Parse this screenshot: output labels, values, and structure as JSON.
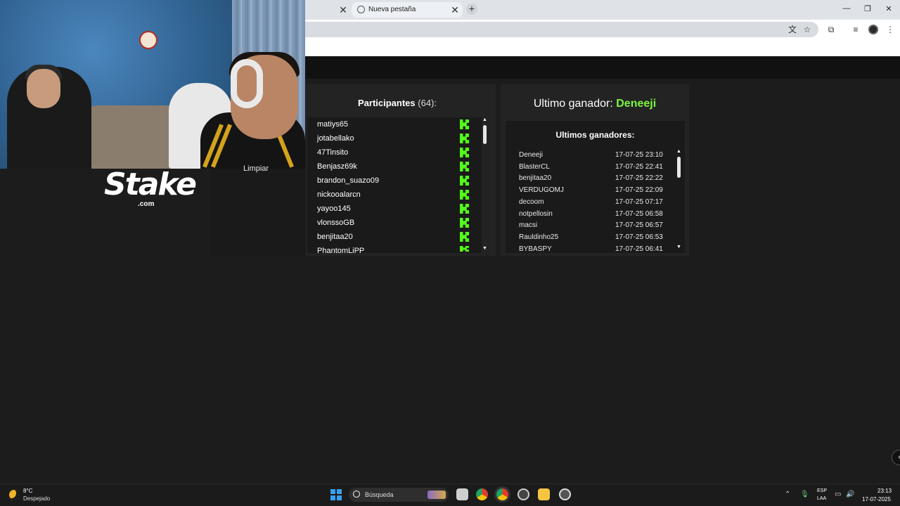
{
  "browser": {
    "active_tab_title": "Nueva pestaña"
  },
  "participants": {
    "title": "Participantes",
    "count": "(64):",
    "rows": [
      {
        "name": "matiys65"
      },
      {
        "name": "jotabellako"
      },
      {
        "name": "47Tinsito"
      },
      {
        "name": "Benjasz69k"
      },
      {
        "name": "brandon_suazo09"
      },
      {
        "name": "nickooalarcn"
      },
      {
        "name": "yayoo145"
      },
      {
        "name": "vlonssoGB"
      },
      {
        "name": "benjitaa20"
      },
      {
        "name": "PhantomLiPP"
      }
    ]
  },
  "winner": {
    "label": "Ultimo ganador:",
    "name": "Deneeji",
    "history_title": "Ultimos ganadores:",
    "history": [
      {
        "name": "Deneeji",
        "date": "17-07-25 23:10"
      },
      {
        "name": "BlasterCL",
        "date": "17-07-25 22:41"
      },
      {
        "name": "benjitaa20",
        "date": "17-07-25 22:22"
      },
      {
        "name": "VERDUGOMJ",
        "date": "17-07-25 22:09"
      },
      {
        "name": "decoom",
        "date": "17-07-25 07:17"
      },
      {
        "name": "notpellosin",
        "date": "17-07-25 06:58"
      },
      {
        "name": "macsi",
        "date": "17-07-25 06:57"
      },
      {
        "name": "Rauldinho25",
        "date": "17-07-25 06:53"
      },
      {
        "name": "BYBASPY",
        "date": "17-07-25 06:41"
      }
    ]
  },
  "overlay": {
    "stake_word": "Stake",
    "stake_com": ".com",
    "limpiar_label": "Limpiar"
  },
  "taskbar": {
    "weather_temp": "8°C",
    "weather_desc": "Despejado",
    "search_placeholder": "Búsqueda",
    "lang_line1": "ESP",
    "lang_line2": "LAA",
    "time": "23:13",
    "date": "17-07-2025"
  },
  "colors": {
    "accent_green": "#7df542",
    "kick_green": "#53fc18"
  }
}
